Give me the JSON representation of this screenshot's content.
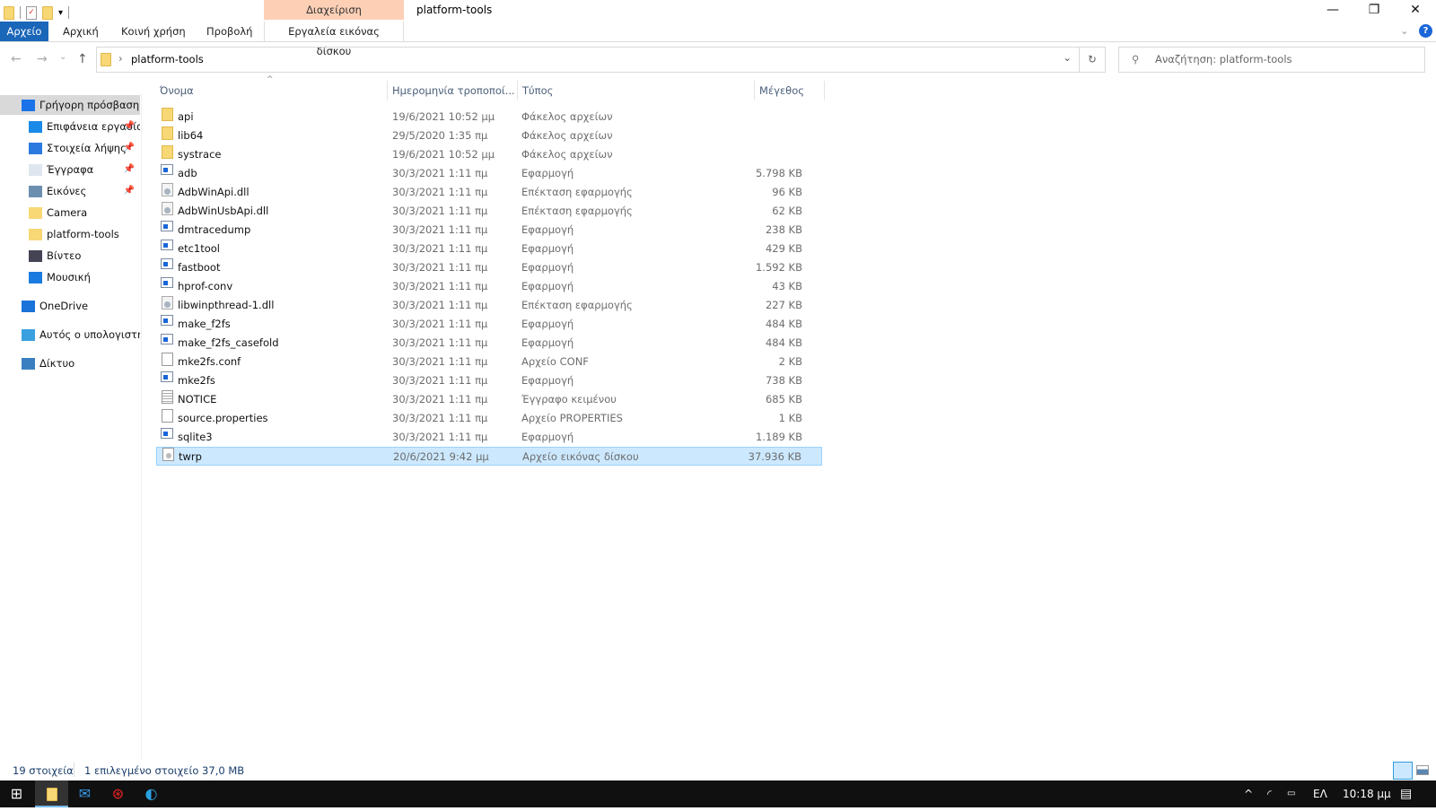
{
  "window": {
    "title": "platform-tools",
    "context_group": "Διαχείριση",
    "minimize": "—",
    "restore": "❐",
    "close": "✕",
    "help": "?",
    "collapse": "⌄"
  },
  "ribbon": {
    "tabs": [
      "Αρχείο",
      "Αρχική",
      "Κοινή χρήση",
      "Προβολή"
    ],
    "context_tab": "Εργαλεία εικόνας δίσκου"
  },
  "address": {
    "path": "platform-tools",
    "separator": "›",
    "dropdown": "⌄",
    "refresh": "↻"
  },
  "nav": {
    "back": "←",
    "forward": "→",
    "recent": "⌄",
    "up": "↑"
  },
  "search": {
    "placeholder": "Αναζήτηση: platform-tools",
    "icon": "⚲"
  },
  "sidebar": {
    "items": [
      {
        "label": "Γρήγορη πρόσβαση",
        "icon": "star-icon",
        "pinned": false
      },
      {
        "label": "Επιφάνεια εργασίας",
        "icon": "desktop-icon",
        "pinned": true
      },
      {
        "label": "Στοιχεία λήψης",
        "icon": "download-icon",
        "pinned": true
      },
      {
        "label": "Έγγραφα",
        "icon": "documents-icon",
        "pinned": true
      },
      {
        "label": "Εικόνες",
        "icon": "pictures-icon",
        "pinned": true
      },
      {
        "label": "Camera",
        "icon": "folder-icon",
        "pinned": false
      },
      {
        "label": "platform-tools",
        "icon": "folder-icon",
        "pinned": false
      },
      {
        "label": "Βίντεο",
        "icon": "video-icon",
        "pinned": false
      },
      {
        "label": "Μουσική",
        "icon": "music-icon",
        "pinned": false
      },
      {
        "label": "OneDrive",
        "icon": "onedrive-icon",
        "pinned": false
      },
      {
        "label": "Αυτός ο υπολογιστής",
        "icon": "computer-icon",
        "pinned": false
      },
      {
        "label": "Δίκτυο",
        "icon": "network-icon",
        "pinned": false
      }
    ],
    "pin_glyph": "📌"
  },
  "columns": {
    "name": "Όνομα",
    "date": "Ημερομηνία τροποποί...",
    "type": "Τύπος",
    "size": "Μέγεθος",
    "sort_glyph": "^"
  },
  "files": [
    {
      "name": "api",
      "date": "19/6/2021 10:52 μμ",
      "type": "Φάκελος αρχείων",
      "size": "",
      "icon": "folder"
    },
    {
      "name": "lib64",
      "date": "29/5/2020 1:35 πμ",
      "type": "Φάκελος αρχείων",
      "size": "",
      "icon": "folder"
    },
    {
      "name": "systrace",
      "date": "19/6/2021 10:52 μμ",
      "type": "Φάκελος αρχείων",
      "size": "",
      "icon": "folder"
    },
    {
      "name": "adb",
      "date": "30/3/2021 1:11 πμ",
      "type": "Εφαρμογή",
      "size": "5.798 KB",
      "icon": "app"
    },
    {
      "name": "AdbWinApi.dll",
      "date": "30/3/2021 1:11 πμ",
      "type": "Επέκταση εφαρμογής",
      "size": "96 KB",
      "icon": "dll"
    },
    {
      "name": "AdbWinUsbApi.dll",
      "date": "30/3/2021 1:11 πμ",
      "type": "Επέκταση εφαρμογής",
      "size": "62 KB",
      "icon": "dll"
    },
    {
      "name": "dmtracedump",
      "date": "30/3/2021 1:11 πμ",
      "type": "Εφαρμογή",
      "size": "238 KB",
      "icon": "app"
    },
    {
      "name": "etc1tool",
      "date": "30/3/2021 1:11 πμ",
      "type": "Εφαρμογή",
      "size": "429 KB",
      "icon": "app"
    },
    {
      "name": "fastboot",
      "date": "30/3/2021 1:11 πμ",
      "type": "Εφαρμογή",
      "size": "1.592 KB",
      "icon": "app"
    },
    {
      "name": "hprof-conv",
      "date": "30/3/2021 1:11 πμ",
      "type": "Εφαρμογή",
      "size": "43 KB",
      "icon": "app"
    },
    {
      "name": "libwinpthread-1.dll",
      "date": "30/3/2021 1:11 πμ",
      "type": "Επέκταση εφαρμογής",
      "size": "227 KB",
      "icon": "dll"
    },
    {
      "name": "make_f2fs",
      "date": "30/3/2021 1:11 πμ",
      "type": "Εφαρμογή",
      "size": "484 KB",
      "icon": "app"
    },
    {
      "name": "make_f2fs_casefold",
      "date": "30/3/2021 1:11 πμ",
      "type": "Εφαρμογή",
      "size": "484 KB",
      "icon": "app"
    },
    {
      "name": "mke2fs.conf",
      "date": "30/3/2021 1:11 πμ",
      "type": "Αρχείο CONF",
      "size": "2 KB",
      "icon": "doc"
    },
    {
      "name": "mke2fs",
      "date": "30/3/2021 1:11 πμ",
      "type": "Εφαρμογή",
      "size": "738 KB",
      "icon": "app"
    },
    {
      "name": "NOTICE",
      "date": "30/3/2021 1:11 πμ",
      "type": "Έγγραφο κειμένου",
      "size": "685 KB",
      "icon": "txt"
    },
    {
      "name": "source.properties",
      "date": "30/3/2021 1:11 πμ",
      "type": "Αρχείο PROPERTIES",
      "size": "1 KB",
      "icon": "doc"
    },
    {
      "name": "sqlite3",
      "date": "30/3/2021 1:11 πμ",
      "type": "Εφαρμογή",
      "size": "1.189 KB",
      "icon": "app"
    },
    {
      "name": "twrp",
      "date": "20/6/2021 9:42 μμ",
      "type": "Αρχείο εικόνας δίσκου",
      "size": "37.936 KB",
      "icon": "img",
      "selected": true
    }
  ],
  "status": {
    "count": "19 στοιχεία",
    "selection": "1 επιλεγμένο στοιχείο  37,0 MB"
  },
  "taskbar": {
    "tray_up": "^",
    "language": "ΕΛ",
    "time": "10:18 μμ"
  },
  "colors": {
    "accent": "#1a66b8",
    "selection": "#cce8ff",
    "context": "#fdd0b6"
  }
}
